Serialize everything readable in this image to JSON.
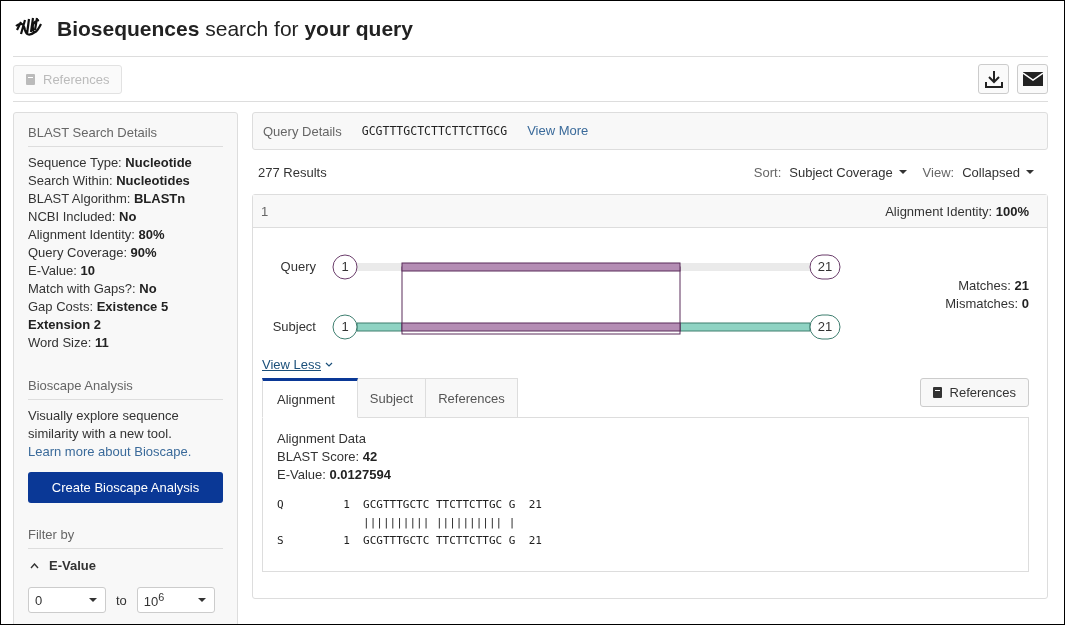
{
  "header": {
    "title": "**Biosequences** search for **your query**"
  },
  "toolbar": {
    "references_button": {
      "label": "References",
      "disabled": true
    }
  },
  "sidebar": {
    "details_title": "BLAST Search Details",
    "details": [
      {
        "label": "Sequence Type:",
        "value": "Nucleotide"
      },
      {
        "label": "Search Within:",
        "value": "Nucleotides"
      },
      {
        "label": "BLAST Algorithm:",
        "value": "BLASTn"
      },
      {
        "label": "NCBI Included:",
        "value": "No"
      },
      {
        "label": "Alignment Identity:",
        "value": "80%"
      },
      {
        "label": "Query Coverage:",
        "value": "90%"
      },
      {
        "label": "E-Value:",
        "value": "10"
      },
      {
        "label": "Match with Gaps?:",
        "value": "No"
      },
      {
        "label": "Gap Costs:",
        "value": "Existence 5 Extension 2"
      },
      {
        "label": "Word Size:",
        "value": "11"
      }
    ],
    "bioscape_title": "Bioscape Analysis",
    "bioscape_text": "Visually explore sequence similarity with a new tool.",
    "bioscape_link": "Learn more about Bioscape.",
    "bioscape_button": "Create Bioscape Analysis",
    "filter_title": "Filter by",
    "filter": {
      "label": "E-Value",
      "expanded": true,
      "from": "0",
      "to_label": "to",
      "to": "10$^{6}$"
    }
  },
  "query_details": {
    "label": "Query Details",
    "sequence": "GCGTTTGCTCTTCTTCTTGCG",
    "link": "View More"
  },
  "results": {
    "count": "277 Results",
    "sort_label": "Sort:",
    "sort_value": "Subject Coverage",
    "view_label": "View:",
    "view_value": "Collapsed"
  },
  "result": {
    "index": "1",
    "identity_label": "Alignment Identity:",
    "identity_value": "100%",
    "graphic": {
      "query_label": "Query",
      "subject_label": "Subject",
      "query_start": "1",
      "query_end": "21",
      "subject_start": "1",
      "subject_end": "21"
    },
    "stats": [
      {
        "label": "Matches:",
        "value": "21"
      },
      {
        "label": "Mismatches:",
        "value": "0"
      }
    ],
    "view_less": "View Less",
    "tabs": [
      {
        "label": "Alignment",
        "selected": true
      },
      {
        "label": "Subject",
        "selected": false
      },
      {
        "label": "References",
        "selected": false
      }
    ],
    "references_button": "References",
    "alignment_title": "Alignment Data",
    "alignment_stats": [
      {
        "label": "BLAST Score:",
        "value": "42"
      },
      {
        "label": "E-Value:",
        "value": "0.0127594"
      }
    ],
    "alignment_lines": [
      "Q         1  GCGTTTGCTC TTCTTCTTGC G  21",
      "             |||||||||| |||||||||| |",
      "S         1  GCGTTTGCTC TTCTTCTTGC G  21"
    ]
  }
}
